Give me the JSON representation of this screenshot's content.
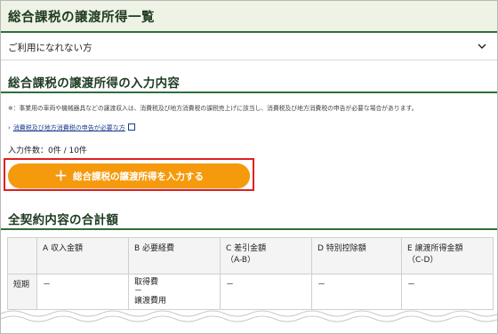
{
  "page": {
    "title": "総合課税の譲渡所得一覧"
  },
  "accordion": {
    "label": "ご利用になれない方"
  },
  "input_section": {
    "title": "総合課税の譲渡所得の入力内容",
    "note": "※：事業用の車両や機械器具などの譲渡収入は、消費税及び地方消費税の課税売上げに該当し、消費税及び地方消費税の申告が必要な場合があります。",
    "link_label": "消費税及び地方消費税の申告が必要な方",
    "count_text": "入力件数：0件 / 10件",
    "add_button_label": "総合課税の譲渡所得を入力する"
  },
  "totals_section": {
    "title": "全契約内容の合計額",
    "columns": [
      "",
      "A 収入金額",
      "B 必要経費",
      "C 差引金額\n（A-B）",
      "D 特別控除額",
      "E 譲渡所得金額\n（C-D）"
    ],
    "rows": [
      {
        "label": "短期",
        "cells": [
          "－",
          "取得費\n－\n譲渡費用",
          "－",
          "－",
          "－"
        ]
      }
    ]
  },
  "colors": {
    "header_bg": "#eef3e6",
    "accent_green": "#2f6e3a",
    "button_orange": "#f59a0c",
    "highlight_red": "#e02020",
    "link_blue": "#1a3e8a"
  },
  "icons": [
    "chevron-down-icon",
    "chevron-right-icon",
    "external-link-icon",
    "plus-icon"
  ]
}
